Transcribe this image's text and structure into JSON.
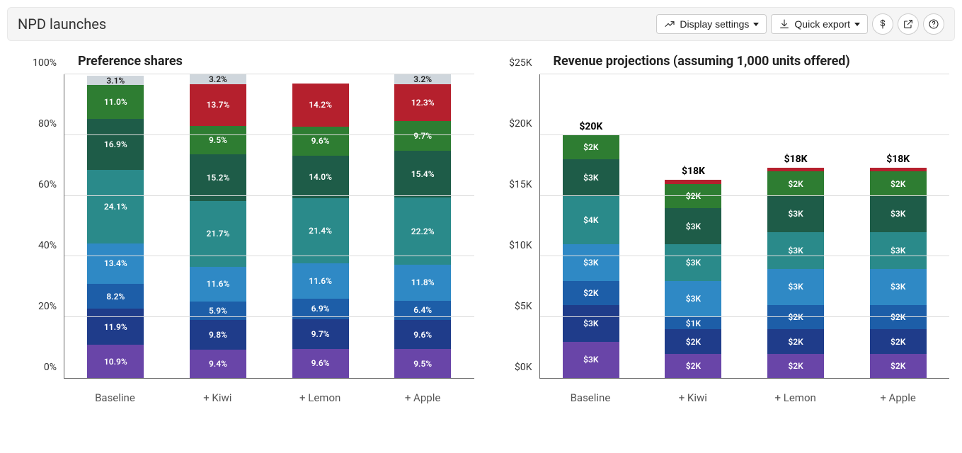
{
  "header": {
    "title": "NPD launches",
    "display_settings": "Display settings",
    "quick_export": "Quick export"
  },
  "colors": {
    "s0": "#6945a8",
    "s1": "#1f3c8a",
    "s2": "#1d5ea8",
    "s3": "#2f89c5",
    "s4": "#2a8a8a",
    "s5": "#1e5c48",
    "s6": "#2e7d32",
    "s7": "#b5202d",
    "s8": "#cfd6dc"
  },
  "chart_data": [
    {
      "type": "bar",
      "stacked": true,
      "title": "Preference shares",
      "ylabel": "",
      "ylim": [
        0,
        100
      ],
      "yticks": [
        "0%",
        "20%",
        "40%",
        "60%",
        "80%",
        "100%"
      ],
      "categories": [
        "Baseline",
        "+ Kiwi",
        "+ Lemon",
        "+ Apple"
      ],
      "format": "percent",
      "bars": [
        {
          "total_label": null,
          "segments": [
            {
              "color_key": "s0",
              "value": 10.9,
              "label": "10.9%"
            },
            {
              "color_key": "s1",
              "value": 11.9,
              "label": "11.9%"
            },
            {
              "color_key": "s2",
              "value": 8.2,
              "label": "8.2%"
            },
            {
              "color_key": "s3",
              "value": 13.4,
              "label": "13.4%"
            },
            {
              "color_key": "s4",
              "value": 24.1,
              "label": "24.1%"
            },
            {
              "color_key": "s5",
              "value": 16.9,
              "label": "16.9%"
            },
            {
              "color_key": "s6",
              "value": 11.0,
              "label": "11.0%"
            },
            {
              "color_key": "s8",
              "value": 3.1,
              "label": "3.1%",
              "dark_text": true
            }
          ]
        },
        {
          "total_label": null,
          "segments": [
            {
              "color_key": "s0",
              "value": 9.4,
              "label": "9.4%"
            },
            {
              "color_key": "s1",
              "value": 9.8,
              "label": "9.8%"
            },
            {
              "color_key": "s2",
              "value": 5.9,
              "label": "5.9%"
            },
            {
              "color_key": "s3",
              "value": 11.6,
              "label": "11.6%"
            },
            {
              "color_key": "s4",
              "value": 21.7,
              "label": "21.7%"
            },
            {
              "color_key": "s5",
              "value": 15.2,
              "label": "15.2%"
            },
            {
              "color_key": "s6",
              "value": 9.5,
              "label": "9.5%"
            },
            {
              "color_key": "s7",
              "value": 13.7,
              "label": "13.7%"
            },
            {
              "color_key": "s8",
              "value": 3.2,
              "label": "3.2%",
              "dark_text": true
            }
          ]
        },
        {
          "total_label": null,
          "segments": [
            {
              "color_key": "s0",
              "value": 9.6,
              "label": "9.6%"
            },
            {
              "color_key": "s1",
              "value": 9.7,
              "label": "9.7%"
            },
            {
              "color_key": "s2",
              "value": 6.9,
              "label": "6.9%"
            },
            {
              "color_key": "s3",
              "value": 11.6,
              "label": "11.6%"
            },
            {
              "color_key": "s4",
              "value": 21.4,
              "label": "21.4%"
            },
            {
              "color_key": "s5",
              "value": 14.0,
              "label": "14.0%"
            },
            {
              "color_key": "s6",
              "value": 9.6,
              "label": "9.6%"
            },
            {
              "color_key": "s7",
              "value": 14.2,
              "label": "14.2%"
            }
          ]
        },
        {
          "total_label": null,
          "segments": [
            {
              "color_key": "s0",
              "value": 9.5,
              "label": "9.5%"
            },
            {
              "color_key": "s1",
              "value": 9.6,
              "label": "9.6%"
            },
            {
              "color_key": "s2",
              "value": 6.4,
              "label": "6.4%"
            },
            {
              "color_key": "s3",
              "value": 11.8,
              "label": "11.8%"
            },
            {
              "color_key": "s4",
              "value": 22.2,
              "label": "22.2%"
            },
            {
              "color_key": "s5",
              "value": 15.4,
              "label": "15.4%"
            },
            {
              "color_key": "s6",
              "value": 9.7,
              "label": "9.7%"
            },
            {
              "color_key": "s7",
              "value": 12.3,
              "label": "12.3%"
            },
            {
              "color_key": "s8",
              "value": 3.2,
              "label": "3.2%",
              "dark_text": true
            }
          ]
        }
      ]
    },
    {
      "type": "bar",
      "stacked": true,
      "title": "Revenue projections (assuming 1,000 units offered)",
      "ylabel": "",
      "ylim": [
        0,
        25
      ],
      "yticks": [
        "$0K",
        "$5K",
        "$10K",
        "$15K",
        "$20K",
        "$25K"
      ],
      "categories": [
        "Baseline",
        "+ Kiwi",
        "+ Lemon",
        "+ Apple"
      ],
      "format": "currency_k",
      "bars": [
        {
          "total_label": "$20K",
          "segments": [
            {
              "color_key": "s0",
              "value": 3,
              "label": "$3K"
            },
            {
              "color_key": "s1",
              "value": 3,
              "label": "$3K"
            },
            {
              "color_key": "s2",
              "value": 2,
              "label": "$2K"
            },
            {
              "color_key": "s3",
              "value": 3,
              "label": "$3K"
            },
            {
              "color_key": "s4",
              "value": 4,
              "label": "$4K"
            },
            {
              "color_key": "s5",
              "value": 3,
              "label": "$3K"
            },
            {
              "color_key": "s6",
              "value": 2,
              "label": "$2K"
            }
          ]
        },
        {
          "total_label": "$18K",
          "segments": [
            {
              "color_key": "s0",
              "value": 2,
              "label": "$2K"
            },
            {
              "color_key": "s1",
              "value": 2,
              "label": "$2K"
            },
            {
              "color_key": "s2",
              "value": 1,
              "label": "$1K"
            },
            {
              "color_key": "s3",
              "value": 3,
              "label": "$3K"
            },
            {
              "color_key": "s4",
              "value": 3,
              "label": "$3K"
            },
            {
              "color_key": "s5",
              "value": 3,
              "label": "$3K"
            },
            {
              "color_key": "s6",
              "value": 2,
              "label": "$2K"
            },
            {
              "color_key": "s7",
              "value": 0.3,
              "label": ""
            }
          ]
        },
        {
          "total_label": "$18K",
          "segments": [
            {
              "color_key": "s0",
              "value": 2,
              "label": "$2K"
            },
            {
              "color_key": "s1",
              "value": 2,
              "label": "$2K"
            },
            {
              "color_key": "s2",
              "value": 2,
              "label": "$2K"
            },
            {
              "color_key": "s3",
              "value": 3,
              "label": "$3K"
            },
            {
              "color_key": "s4",
              "value": 3,
              "label": "$3K"
            },
            {
              "color_key": "s5",
              "value": 3,
              "label": "$3K"
            },
            {
              "color_key": "s6",
              "value": 2,
              "label": "$2K"
            },
            {
              "color_key": "s7",
              "value": 0.3,
              "label": ""
            }
          ]
        },
        {
          "total_label": "$18K",
          "segments": [
            {
              "color_key": "s0",
              "value": 2,
              "label": "$2K"
            },
            {
              "color_key": "s1",
              "value": 2,
              "label": "$2K"
            },
            {
              "color_key": "s2",
              "value": 2,
              "label": "$2K"
            },
            {
              "color_key": "s3",
              "value": 3,
              "label": "$3K"
            },
            {
              "color_key": "s4",
              "value": 3,
              "label": "$3K"
            },
            {
              "color_key": "s5",
              "value": 3,
              "label": "$3K"
            },
            {
              "color_key": "s6",
              "value": 2,
              "label": "$2K"
            },
            {
              "color_key": "s7",
              "value": 0.3,
              "label": ""
            }
          ]
        }
      ]
    }
  ]
}
